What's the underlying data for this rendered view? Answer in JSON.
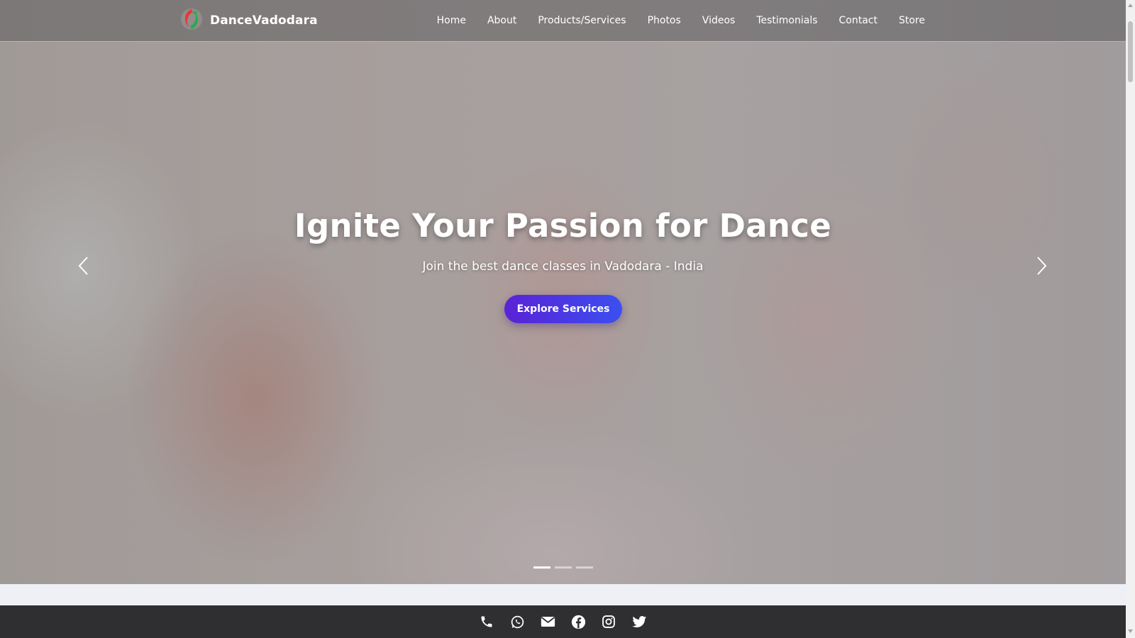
{
  "brand": {
    "name": "DanceVadodara",
    "logo_icon": "dance-logo-icon",
    "logo_colors": [
      "#e53935",
      "#2fa84f"
    ]
  },
  "nav": {
    "items": [
      {
        "label": "Home"
      },
      {
        "label": "About"
      },
      {
        "label": "Products/Services"
      },
      {
        "label": "Photos"
      },
      {
        "label": "Videos"
      },
      {
        "label": "Testimonials"
      },
      {
        "label": "Contact"
      },
      {
        "label": "Store"
      }
    ]
  },
  "hero": {
    "title": "Ignite Your Passion for Dance",
    "subtitle": "Join the best dance classes in Vadodara - India",
    "cta_label": "Explore Services",
    "cta_colors": [
      "#5a22d6",
      "#3b4ff0"
    ],
    "slides_count": 3,
    "active_slide": 1
  },
  "social": {
    "icons": [
      "phone-icon",
      "whatsapp-icon",
      "email-icon",
      "facebook-icon",
      "instagram-icon",
      "twitter-icon"
    ],
    "bar_color": "#2f2f31"
  }
}
